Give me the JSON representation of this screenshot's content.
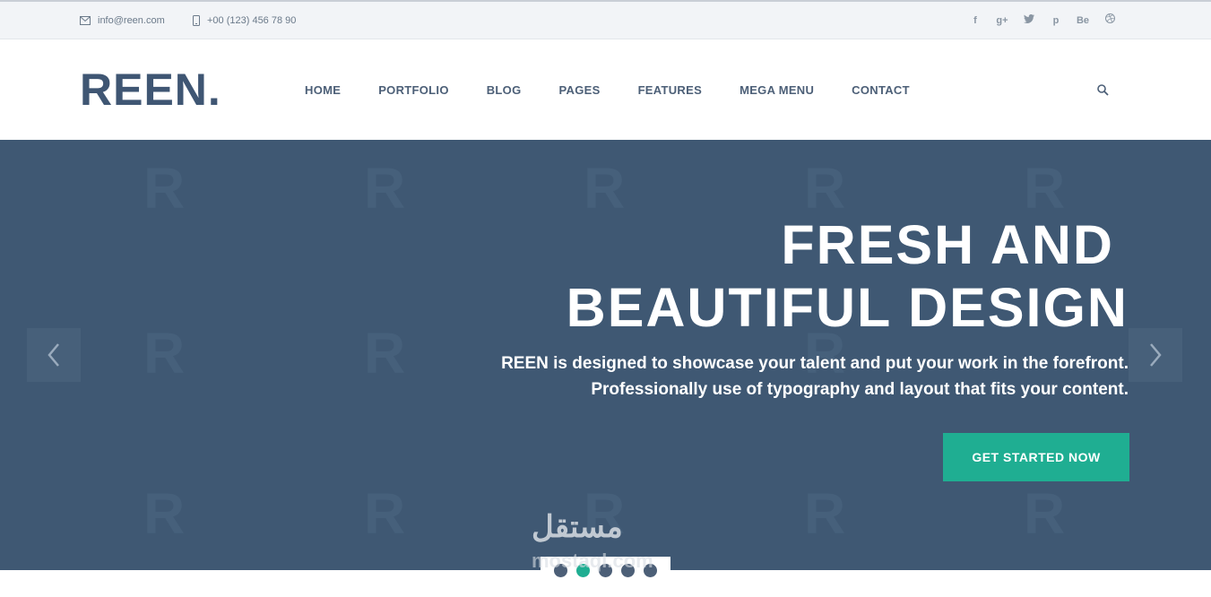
{
  "topbar": {
    "email": "info@reen.com",
    "phone": "+00 (123) 456 78 90",
    "social": [
      "f",
      "g+",
      "t",
      "p",
      "Be",
      "dribbble"
    ]
  },
  "header": {
    "logo": "REEN.",
    "nav": [
      "HOME",
      "PORTFOLIO",
      "BLOG",
      "PAGES",
      "FEATURES",
      "MEGA MENU",
      "CONTACT"
    ]
  },
  "hero": {
    "headline_line1": "FRESH AND",
    "headline_line2": "BEAUTIFUL DESIGN",
    "subtext_line1": "REEN is designed to showcase your talent and put your work in the forefront.",
    "subtext_line2": "Professionally use of typography and layout that fits your content.",
    "cta_label": "GET STARTED NOW",
    "watermark_letter": "R",
    "slides": 5,
    "active_slide": 2
  },
  "overlay_badge": {
    "arabic": "مستقل",
    "latin": "mostaql.com"
  },
  "colors": {
    "brand": "#3f5673",
    "hero_bg": "#3f5873",
    "accent": "#1fae92"
  }
}
